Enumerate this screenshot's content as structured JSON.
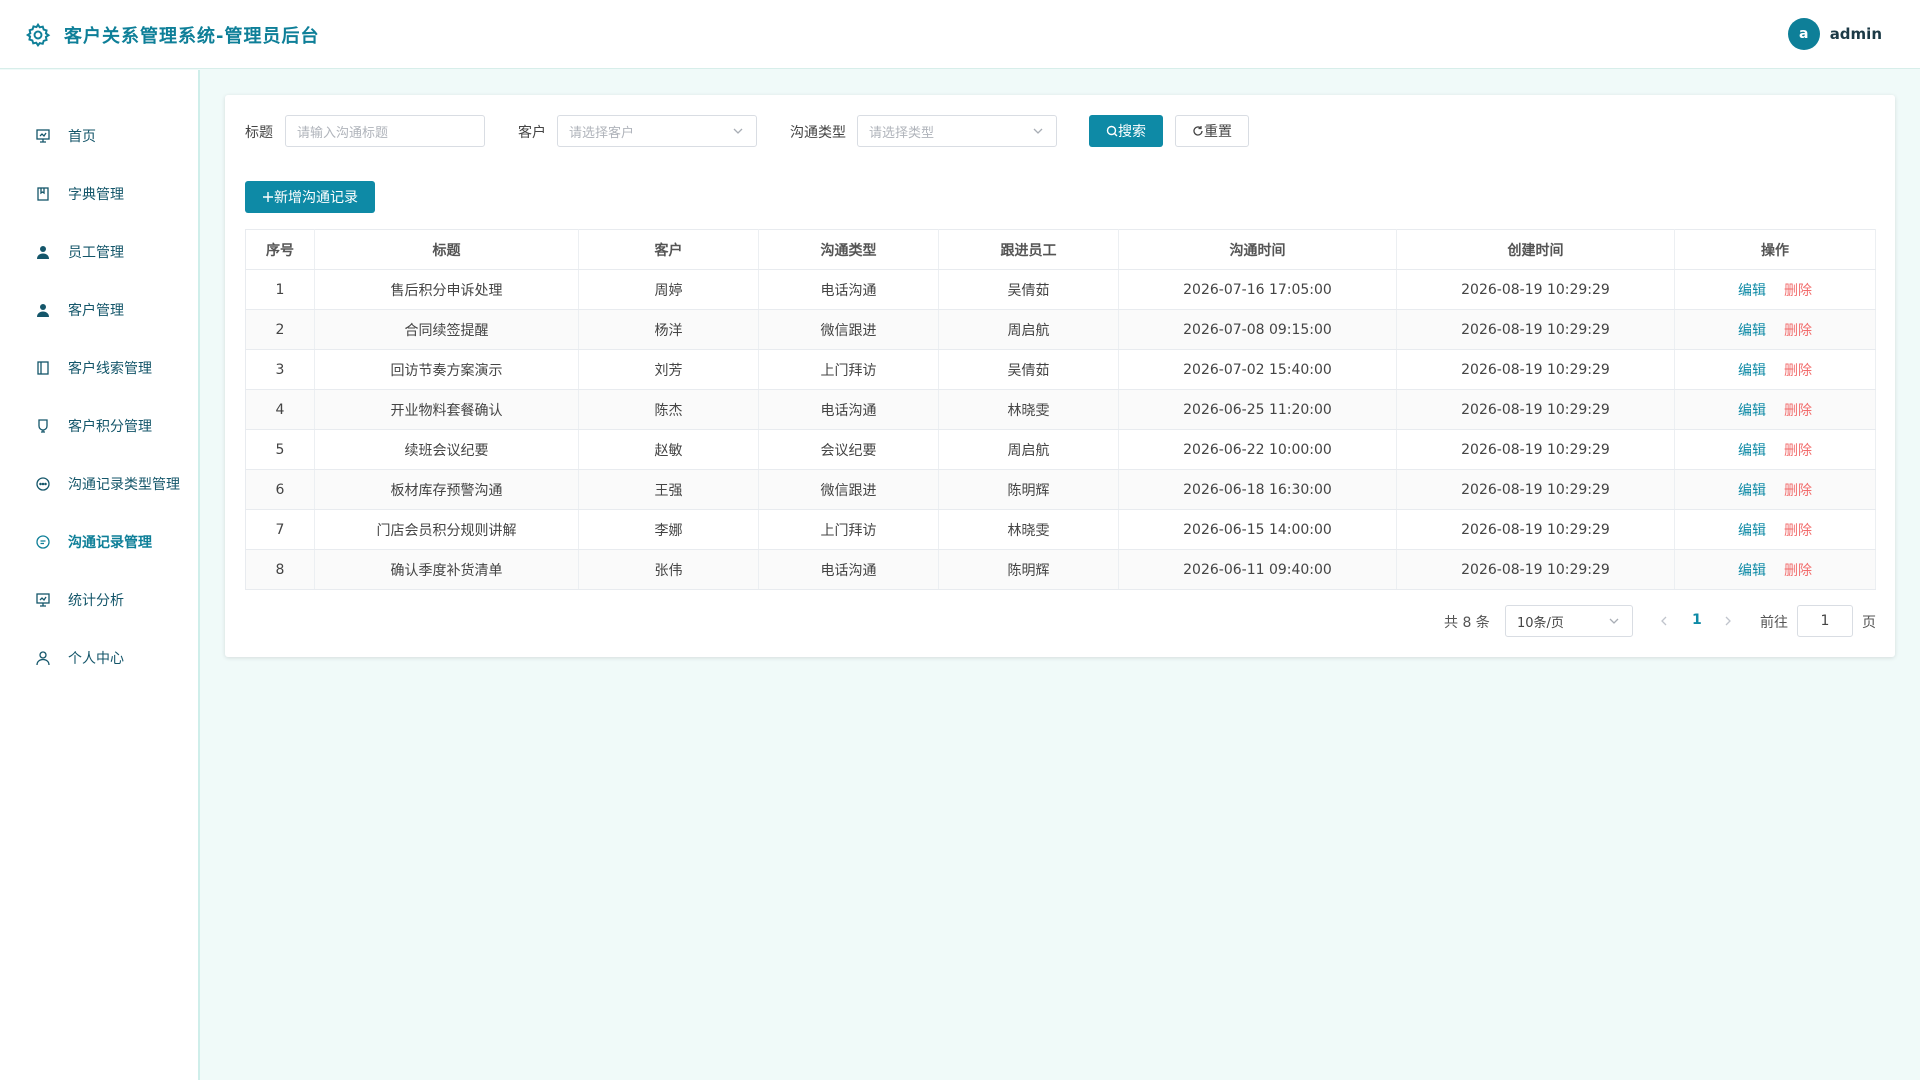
{
  "app": {
    "title": "客户关系管理系统-管理员后台"
  },
  "user": {
    "avatar_letter": "a",
    "name": "admin"
  },
  "sidebar": {
    "items": [
      {
        "label": "首页",
        "icon": "dashboard-icon"
      },
      {
        "label": "字典管理",
        "icon": "book-icon"
      },
      {
        "label": "员工管理",
        "icon": "user-icon"
      },
      {
        "label": "客户管理",
        "icon": "user-icon"
      },
      {
        "label": "客户线索管理",
        "icon": "notebook-icon"
      },
      {
        "label": "客户积分管理",
        "icon": "cup-icon"
      },
      {
        "label": "沟通记录类型管理",
        "icon": "chat-dots-icon"
      },
      {
        "label": "沟通记录管理",
        "icon": "chat-line-icon"
      },
      {
        "label": "统计分析",
        "icon": "chart-icon"
      },
      {
        "label": "个人中心",
        "icon": "person-icon"
      }
    ],
    "active_index": 7
  },
  "filters": {
    "title_label": "标题",
    "title_placeholder": "请输入沟通标题",
    "customer_label": "客户",
    "customer_placeholder": "请选择客户",
    "type_label": "沟通类型",
    "type_placeholder": "请选择类型",
    "search_label": "搜索",
    "reset_label": "重置"
  },
  "add_button_label": "新增沟通记录",
  "table": {
    "columns": [
      "序号",
      "标题",
      "客户",
      "沟通类型",
      "跟进员工",
      "沟通时间",
      "创建时间",
      "操作"
    ],
    "rows": [
      [
        "1",
        "售后积分申诉处理",
        "周婷",
        "电话沟通",
        "吴倩茹",
        "2026-07-16 17:05:00",
        "2026-08-19 10:29:29"
      ],
      [
        "2",
        "合同续签提醒",
        "杨洋",
        "微信跟进",
        "周启航",
        "2026-07-08 09:15:00",
        "2026-08-19 10:29:29"
      ],
      [
        "3",
        "回访节奏方案演示",
        "刘芳",
        "上门拜访",
        "吴倩茹",
        "2026-07-02 15:40:00",
        "2026-08-19 10:29:29"
      ],
      [
        "4",
        "开业物料套餐确认",
        "陈杰",
        "电话沟通",
        "林晓雯",
        "2026-06-25 11:20:00",
        "2026-08-19 10:29:29"
      ],
      [
        "5",
        "续班会议纪要",
        "赵敏",
        "会议纪要",
        "周启航",
        "2026-06-22 10:00:00",
        "2026-08-19 10:29:29"
      ],
      [
        "6",
        "板材库存预警沟通",
        "王强",
        "微信跟进",
        "陈明辉",
        "2026-06-18 16:30:00",
        "2026-08-19 10:29:29"
      ],
      [
        "7",
        "门店会员积分规则讲解",
        "李娜",
        "上门拜访",
        "林晓雯",
        "2026-06-15 14:00:00",
        "2026-08-19 10:29:29"
      ],
      [
        "8",
        "确认季度补货清单",
        "张伟",
        "电话沟通",
        "陈明辉",
        "2026-06-11 09:40:00",
        "2026-08-19 10:29:29"
      ]
    ],
    "edit_label": "编辑",
    "delete_label": "删除"
  },
  "pagination": {
    "total_text": "共 8 条",
    "page_size": "10条/页",
    "current_page": "1",
    "goto_label": "前往",
    "goto_value": "1",
    "page_suffix": "页"
  },
  "colors": {
    "accent": "#0e8aa6",
    "danger": "#f26c6c",
    "background": "#f0faf9"
  }
}
